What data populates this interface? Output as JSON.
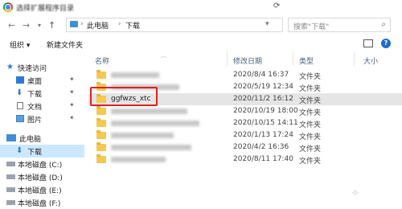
{
  "window": {
    "title": "选择扩展程序目录"
  },
  "nav": {
    "back_icon": "back-arrow-icon",
    "forward_icon": "forward-arrow-icon",
    "recent_icon": "chevron-down-icon",
    "up_icon": "up-arrow-icon",
    "breadcrumb": [
      "此电脑",
      "下载"
    ],
    "search_placeholder": "搜索\"下载\""
  },
  "toolbar": {
    "organize_label": "组织 ▾",
    "new_folder_label": "新建文件夹"
  },
  "sidebar": {
    "items": [
      {
        "label": "快速访问",
        "icon": "star-icon"
      },
      {
        "label": "桌面",
        "icon": "desktop-icon",
        "pinned": true
      },
      {
        "label": "下载",
        "icon": "download-icon",
        "pinned": true
      },
      {
        "label": "文档",
        "icon": "document-icon",
        "pinned": true
      },
      {
        "label": "图片",
        "icon": "picture-icon",
        "pinned": true
      },
      {
        "label": "此电脑",
        "icon": "computer-icon"
      },
      {
        "label": "下载",
        "icon": "download-icon",
        "selected": true
      },
      {
        "label": "本地磁盘 (C:)",
        "icon": "drive-icon"
      },
      {
        "label": "本地磁盘 (D:)",
        "icon": "drive-icon"
      },
      {
        "label": "本地磁盘 (E:)",
        "icon": "drive-icon"
      },
      {
        "label": "本地磁盘 (F:)",
        "icon": "drive-icon"
      }
    ]
  },
  "columns": {
    "name": "名称",
    "date": "修改日期",
    "type": "类型",
    "size": "大小"
  },
  "files": [
    {
      "name": "",
      "date": "2020/8/4 16:37",
      "type": "文件夹"
    },
    {
      "name": "",
      "date": "2020/5/19 12:34",
      "type": "文件夹"
    },
    {
      "name": "ggfwzs_xtc",
      "date": "2020/11/2 16:12",
      "type": "文件夹",
      "selected": true
    },
    {
      "name": "",
      "date": "2020/10/19 18:00",
      "type": "文件夹"
    },
    {
      "name": "",
      "date": "2020/10/15 14:11",
      "type": "文件夹"
    },
    {
      "name": "",
      "date": "2020/1/13 17:24",
      "type": "文件夹"
    },
    {
      "name": "",
      "date": "2020/4/2 16:36",
      "type": "文件夹"
    },
    {
      "name": "",
      "date": "2020/8/11 17:40",
      "type": "文件夹"
    }
  ],
  "colors": {
    "selection": "#cce8ff",
    "highlight": "#e02020",
    "folder": "#f5c852"
  }
}
